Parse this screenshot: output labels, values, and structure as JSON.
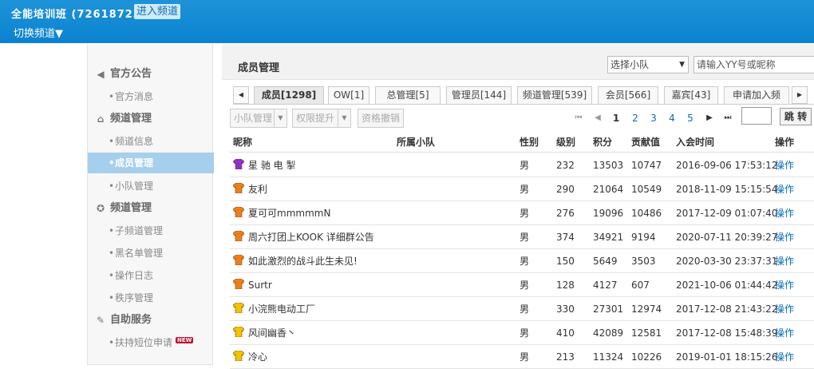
{
  "header": {
    "title": "全能培训班 (72618723)",
    "enter_label": "进入频道",
    "switch_label": "切换频道▼"
  },
  "sidebar": {
    "groups": [
      {
        "label": "官方公告",
        "icon": "speaker-icon"
      },
      {
        "label": "频道管理",
        "icon": "home-icon"
      },
      {
        "label": "频道管理",
        "icon": "shield-gear-icon"
      },
      {
        "label": "自助服务",
        "icon": "wrench-icon"
      }
    ],
    "items": [
      {
        "label": "官方消息"
      },
      {
        "label": "频道信息"
      },
      {
        "label": "成员管理",
        "active": true
      },
      {
        "label": "小队管理"
      },
      {
        "label": "子频道管理"
      },
      {
        "label": "黑名单管理"
      },
      {
        "label": "操作日志"
      },
      {
        "label": "秩序管理"
      },
      {
        "label": "扶持短位申请",
        "badge": "NEW"
      }
    ]
  },
  "main": {
    "title": "成员管理",
    "team_select": "选择小队",
    "search_placeholder": "请输入YY号或昵称"
  },
  "tabs": [
    {
      "label": "成员[1298]",
      "active": true
    },
    {
      "label": "OW[1]"
    },
    {
      "label": "总管理[5]"
    },
    {
      "label": "管理员[144]"
    },
    {
      "label": "频道管理[539]"
    },
    {
      "label": "会员[566]"
    },
    {
      "label": "嘉宾[43]"
    },
    {
      "label": "申请加入频"
    }
  ],
  "toolbar": {
    "team_manage": "小队管理",
    "raise_perm": "权限提升",
    "revoke": "资格撤销"
  },
  "pager": {
    "current": "1",
    "pages": [
      "2",
      "3",
      "4",
      "5"
    ],
    "jump_label": "跳 转"
  },
  "table": {
    "headers": {
      "nickname": "昵称",
      "team": "所属小队",
      "gender": "性别",
      "level": "级别",
      "points": "积分",
      "contribution": "贡献值",
      "join_time": "入会时间",
      "action": "操作"
    },
    "rows": [
      {
        "shirt": "#8e2fcf",
        "nickname": "星 驰 电 掣",
        "team": "",
        "gender": "男",
        "level": "232",
        "points": "13503",
        "contribution": "10747",
        "join_time": "2016-09-06 17:53:12",
        "action": "操作"
      },
      {
        "shirt": "#f07d1c",
        "nickname": "友利",
        "team": "",
        "gender": "男",
        "level": "290",
        "points": "21064",
        "contribution": "10549",
        "join_time": "2018-11-09 15:15:54",
        "action": "操作"
      },
      {
        "shirt": "#f07d1c",
        "nickname": "夏可可mmmmmN",
        "team": "",
        "gender": "男",
        "level": "276",
        "points": "19096",
        "contribution": "10486",
        "join_time": "2017-12-09 01:07:40",
        "action": "操作"
      },
      {
        "shirt": "#f07d1c",
        "nickname": "周六打团上KOOK 详细群公告",
        "team": "",
        "gender": "男",
        "level": "374",
        "points": "34921",
        "contribution": "9194",
        "join_time": "2020-07-11 20:39:27",
        "action": "操作"
      },
      {
        "shirt": "#f07d1c",
        "nickname": "如此激烈的战斗此生未见!",
        "team": "",
        "gender": "男",
        "level": "150",
        "points": "5649",
        "contribution": "3503",
        "join_time": "2020-03-30 23:37:31",
        "action": "操作"
      },
      {
        "shirt": "#f07d1c",
        "nickname": "Surtr",
        "team": "",
        "gender": "男",
        "level": "128",
        "points": "4127",
        "contribution": "607",
        "join_time": "2021-10-06 01:44:42",
        "action": "操作"
      },
      {
        "shirt": "#f2c400",
        "nickname": "小浣熊电动工厂",
        "team": "",
        "gender": "男",
        "level": "330",
        "points": "27301",
        "contribution": "12974",
        "join_time": "2017-12-08 21:43:22",
        "action": "操作"
      },
      {
        "shirt": "#f2c400",
        "nickname": "风间幽香丶",
        "team": "",
        "gender": "男",
        "level": "410",
        "points": "42089",
        "contribution": "12581",
        "join_time": "2017-12-08 15:48:39",
        "action": "操作"
      },
      {
        "shirt": "#f2c400",
        "nickname": "冷心",
        "team": "",
        "gender": "男",
        "level": "213",
        "points": "11324",
        "contribution": "10226",
        "join_time": "2019-01-01 18:15:26",
        "action": "操作"
      }
    ]
  }
}
